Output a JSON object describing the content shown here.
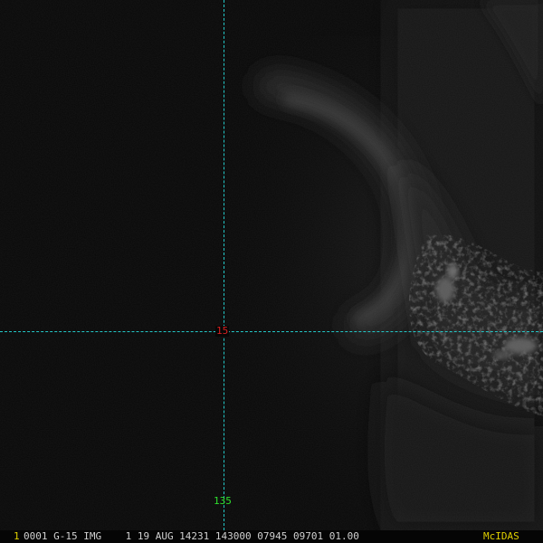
{
  "colors": {
    "background": "#070707",
    "gridline": "#23c7c7",
    "latitude_label": "#d82020",
    "longitude_label": "#2ee02e",
    "status_text": "#d0d0d0",
    "highlight": "#e0d000"
  },
  "grid": {
    "latitude_label": "15",
    "longitude_label": "135"
  },
  "status_bar": {
    "frame_number": "1",
    "header": "0001 G-15 IMG    1 19 AUG 14231 143000 07945 09701 01.00",
    "brand": "McIDAS"
  }
}
